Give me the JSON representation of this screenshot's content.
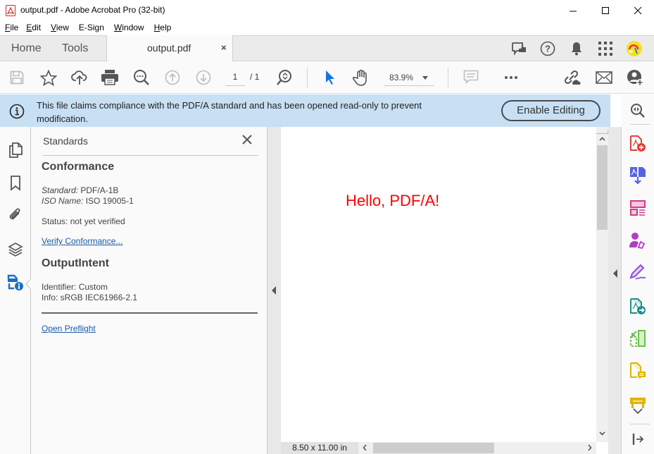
{
  "window": {
    "title": "output.pdf - Adobe Acrobat Pro (32-bit)",
    "controls": [
      "minimize",
      "maximize",
      "close"
    ]
  },
  "menu": {
    "items": [
      {
        "label": "File",
        "accel": "F"
      },
      {
        "label": "Edit",
        "accel": "E"
      },
      {
        "label": "View",
        "accel": "V"
      },
      {
        "label": "E-Sign",
        "accel": ""
      },
      {
        "label": "Window",
        "accel": "W"
      },
      {
        "label": "Help",
        "accel": "H"
      }
    ]
  },
  "tabs": {
    "home": "Home",
    "tools": "Tools",
    "document": "output.pdf",
    "close_glyph": "×",
    "right_icons": [
      "share-feedback-icon",
      "help-icon",
      "notifications-bell-icon",
      "apps-grid-icon",
      "user-avatar"
    ]
  },
  "toolbar": {
    "page_current": "1",
    "page_total": "/ 1",
    "zoom_level": "83.9%",
    "icons": [
      "save-icon",
      "bookmark-star-icon",
      "upload-cloud-icon",
      "print-icon",
      "find-icon",
      "prev-page-icon",
      "next-page-icon",
      "page-zoom-icon",
      "select-pointer-icon",
      "hand-tool-icon",
      "comment-icon",
      "more-icon",
      "share-link-icon",
      "email-icon",
      "add-user-icon"
    ]
  },
  "banner": {
    "message": "This file claims compliance with the PDF/A standard and has been opened read-only to prevent modification.",
    "button": "Enable Editing"
  },
  "left_rail": {
    "icons": [
      "page-thumbnails-icon",
      "bookmarks-icon",
      "attachments-icon",
      "layers-icon",
      "standards-icon"
    ],
    "active": "standards-icon"
  },
  "standards_panel": {
    "title": "Standards",
    "conformance": {
      "heading": "Conformance",
      "standard_label": "Standard:",
      "standard_value": "PDF/A-1B",
      "iso_label": "ISO Name:",
      "iso_value": "ISO 19005-1",
      "status": "Status: not yet verified",
      "verify_link": "Verify Conformance..."
    },
    "output_intent": {
      "heading": "OutputIntent",
      "identifier": "Identifier: Custom",
      "info": "Info: sRGB IEC61966-2.1"
    },
    "preflight_link": "Open Preflight"
  },
  "document": {
    "content_text": "Hello, PDF/A!",
    "text_color": "#ff0000",
    "page_size": "8.50 x 11.00 in"
  },
  "right_rail": {
    "icons": [
      {
        "name": "zoom-tool-icon",
        "color": "#555555"
      },
      {
        "name": "create-pdf-icon",
        "color": "#e0403c"
      },
      {
        "name": "combine-files-icon",
        "color": "#5663e0"
      },
      {
        "name": "organize-pages-icon",
        "color": "#d43a84"
      },
      {
        "name": "request-signature-icon",
        "color": "#b33bc7"
      },
      {
        "name": "fill-sign-icon",
        "color": "#8a4fd8"
      },
      {
        "name": "export-pdf-icon",
        "color": "#1e8f8a"
      },
      {
        "name": "compress-pdf-icon",
        "color": "#6cc04a"
      },
      {
        "name": "comment-tool-icon",
        "color": "#e0b400"
      },
      {
        "name": "stamp-tool-icon",
        "color": "#e0b400"
      }
    ]
  },
  "colors": {
    "accent_blue": "#1473e6",
    "banner_bg": "#c7e0f4",
    "link": "#1b5aa8"
  }
}
